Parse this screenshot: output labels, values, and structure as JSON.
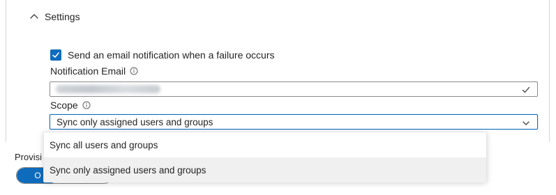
{
  "settings": {
    "title": "Settings"
  },
  "notification": {
    "checkbox_label": "Send an email notification when a failure occurs",
    "checked": true,
    "email_label": "Notification Email"
  },
  "scope": {
    "label": "Scope",
    "selected": "Sync only assigned users and groups",
    "options": [
      {
        "label": "Sync all users and groups"
      },
      {
        "label": "Sync only assigned users and groups"
      }
    ]
  },
  "provisioning": {
    "label": "Provisi",
    "toggle_on": "O"
  },
  "colors": {
    "accent": "#0f6cbd",
    "selected_bg": "#f0f0f0"
  }
}
